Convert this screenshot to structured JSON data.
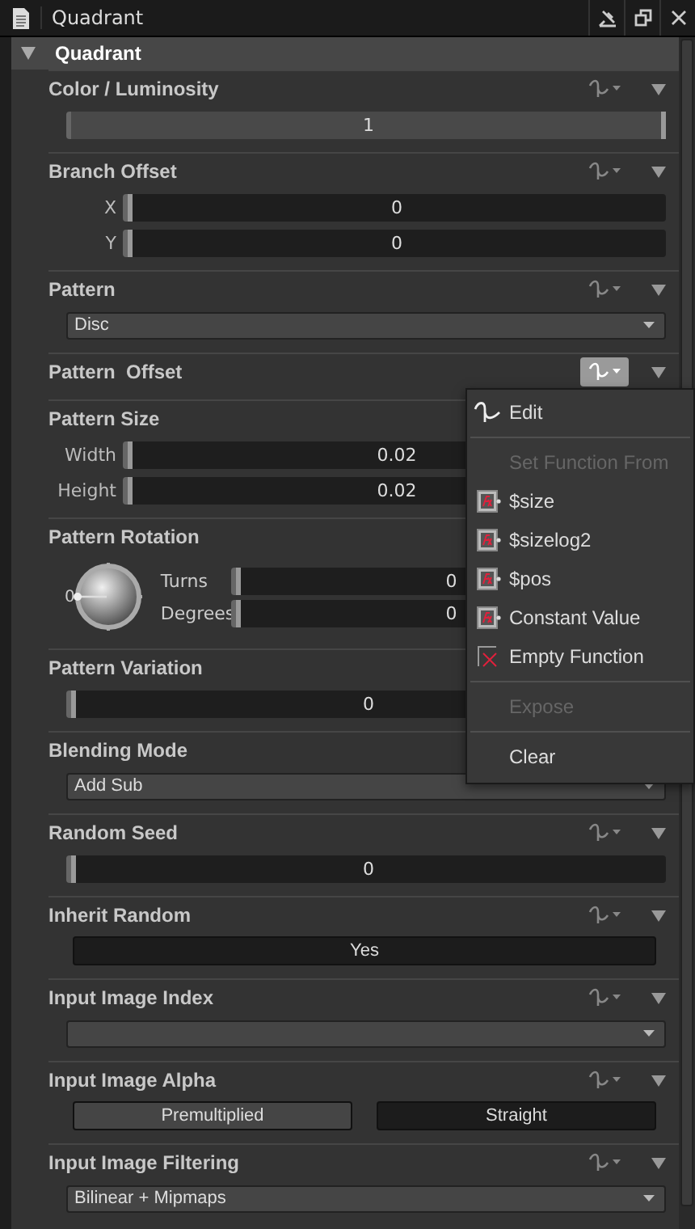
{
  "window": {
    "title": "Quadrant"
  },
  "group": {
    "title": "Quadrant",
    "expanded": true
  },
  "sections": [
    {
      "kind": "sliders",
      "title": "Color / Luminosity",
      "function_active": false,
      "rows": [
        {
          "value": "1",
          "level": 1
        }
      ]
    },
    {
      "kind": "sliders",
      "title": "Branch Offset",
      "function_active": false,
      "rows": [
        {
          "label": "X",
          "value": "0",
          "level": 0
        },
        {
          "label": "Y",
          "value": "0",
          "level": 0
        }
      ]
    },
    {
      "kind": "dropdown",
      "title": "Pattern",
      "function_active": false,
      "value": "Disc"
    },
    {
      "kind": "header",
      "title": "Pattern  Offset",
      "function_active": true
    },
    {
      "kind": "sliders",
      "title": "Pattern Size",
      "rows": [
        {
          "label": "Width",
          "value": "0.02",
          "level": 0
        },
        {
          "label": "Height",
          "value": "0.02",
          "level": 0
        }
      ]
    },
    {
      "kind": "angle",
      "title": "Pattern Rotation",
      "dial_label": "0",
      "rows": [
        {
          "label": "Turns",
          "value": "0",
          "level": 0
        },
        {
          "label": "Degrees",
          "value": "0",
          "level": 0
        }
      ]
    },
    {
      "kind": "sliders",
      "title": "Pattern Variation",
      "rows": [
        {
          "value": "0",
          "level": 0
        }
      ]
    },
    {
      "kind": "dropdown",
      "title": "Blending Mode",
      "value": "Add Sub"
    },
    {
      "kind": "sliders",
      "title": "Random Seed",
      "function_active": false,
      "rows": [
        {
          "value": "0",
          "level": 0
        }
      ]
    },
    {
      "kind": "toggle",
      "title": "Inherit Random",
      "function_active": false,
      "button": {
        "label": "Yes",
        "on": true
      }
    },
    {
      "kind": "dropdown",
      "title": "Input Image Index",
      "function_active": false
    },
    {
      "kind": "segmented",
      "title": "Input Image Alpha",
      "function_active": false,
      "options": [
        {
          "label": "Premultiplied",
          "selected": false
        },
        {
          "label": "Straight",
          "selected": true
        }
      ]
    },
    {
      "kind": "dropdown",
      "title": "Input Image Filtering",
      "function_active": false,
      "value": "Bilinear + Mipmaps"
    }
  ],
  "menu": {
    "items": [
      {
        "kind": "edit",
        "label": "Edit",
        "disabled": false
      },
      {
        "kind": "separator"
      },
      {
        "kind": "plain",
        "label": "Set Function From",
        "disabled": true
      },
      {
        "kind": "function",
        "label": "$size",
        "disabled": false
      },
      {
        "kind": "function",
        "label": "$sizelog2",
        "disabled": false
      },
      {
        "kind": "function",
        "label": "$pos",
        "disabled": false
      },
      {
        "kind": "function",
        "label": "Constant Value",
        "disabled": false
      },
      {
        "kind": "empty",
        "label": "Empty Function",
        "disabled": false
      },
      {
        "kind": "separator"
      },
      {
        "kind": "plain",
        "label": "Expose",
        "disabled": true
      },
      {
        "kind": "separator"
      },
      {
        "kind": "plain",
        "label": "Clear",
        "disabled": false
      }
    ]
  }
}
